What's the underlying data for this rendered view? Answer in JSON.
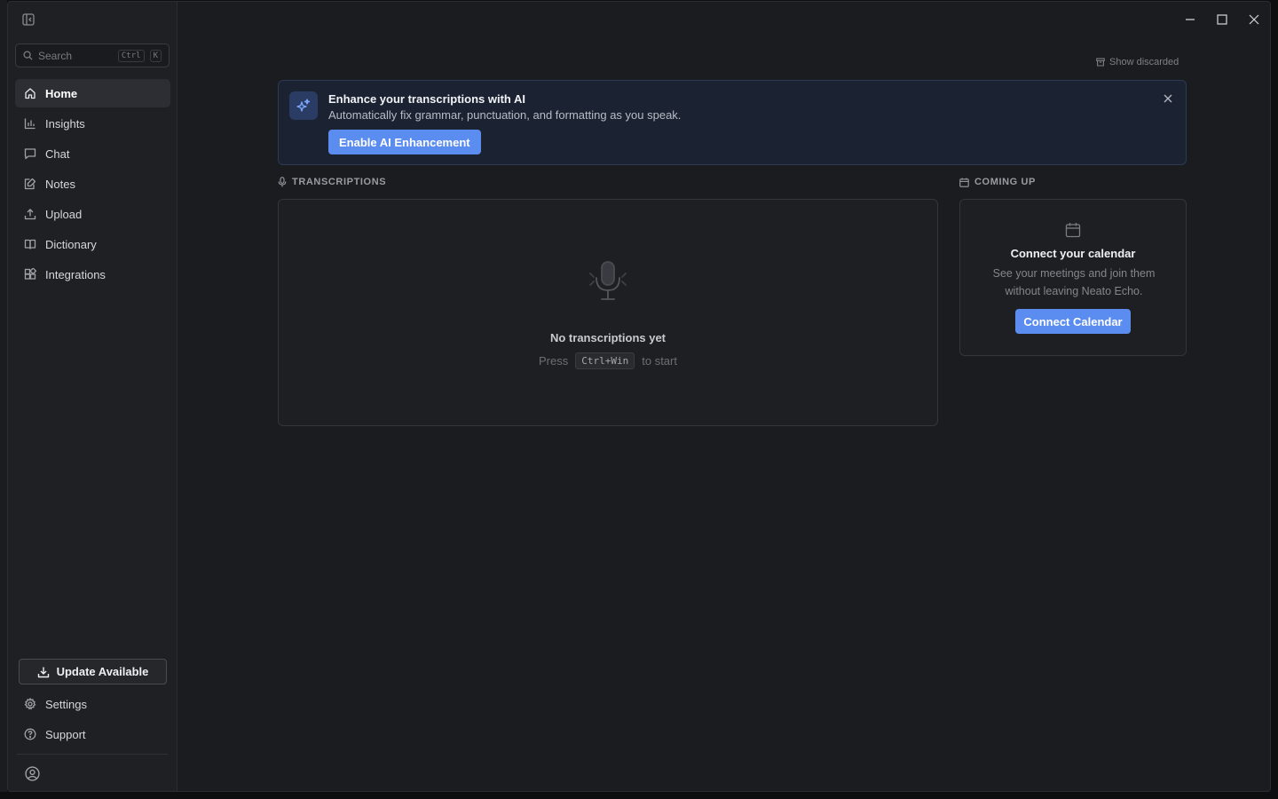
{
  "sidebar": {
    "search": {
      "placeholder": "Search",
      "shortcut_keys": [
        "Ctrl",
        "K"
      ]
    },
    "nav_items": [
      {
        "label": "Home",
        "icon": "home-icon",
        "active": true
      },
      {
        "label": "Insights",
        "icon": "chart-icon",
        "active": false
      },
      {
        "label": "Chat",
        "icon": "chat-icon",
        "active": false
      },
      {
        "label": "Notes",
        "icon": "notes-icon",
        "active": false
      },
      {
        "label": "Upload",
        "icon": "upload-icon",
        "active": false
      },
      {
        "label": "Dictionary",
        "icon": "book-icon",
        "active": false
      },
      {
        "label": "Integrations",
        "icon": "puzzle-icon",
        "active": false
      }
    ],
    "update_button": "Update Available",
    "bottom_items": [
      {
        "label": "Settings",
        "icon": "gear-icon"
      },
      {
        "label": "Support",
        "icon": "help-icon"
      }
    ]
  },
  "main": {
    "show_discarded": "Show discarded",
    "banner": {
      "title": "Enhance your transcriptions with AI",
      "description": "Automatically fix grammar, punctuation, and formatting as you speak.",
      "button": "Enable AI Enhancement"
    },
    "transcriptions": {
      "section_label": "TRANSCRIPTIONS",
      "empty_title": "No transcriptions yet",
      "hint_prefix": "Press",
      "hint_key": "Ctrl+Win",
      "hint_suffix": "to start"
    },
    "coming_up": {
      "section_label": "COMING UP",
      "title": "Connect your calendar",
      "description": "See your meetings and join them without leaving Neato Echo.",
      "button": "Connect Calendar"
    }
  },
  "colors": {
    "accent": "#5b8cf0",
    "window_bg": "#1b1c1f",
    "sidebar_bg": "#1f2023",
    "banner_bg": "#1b2231"
  }
}
